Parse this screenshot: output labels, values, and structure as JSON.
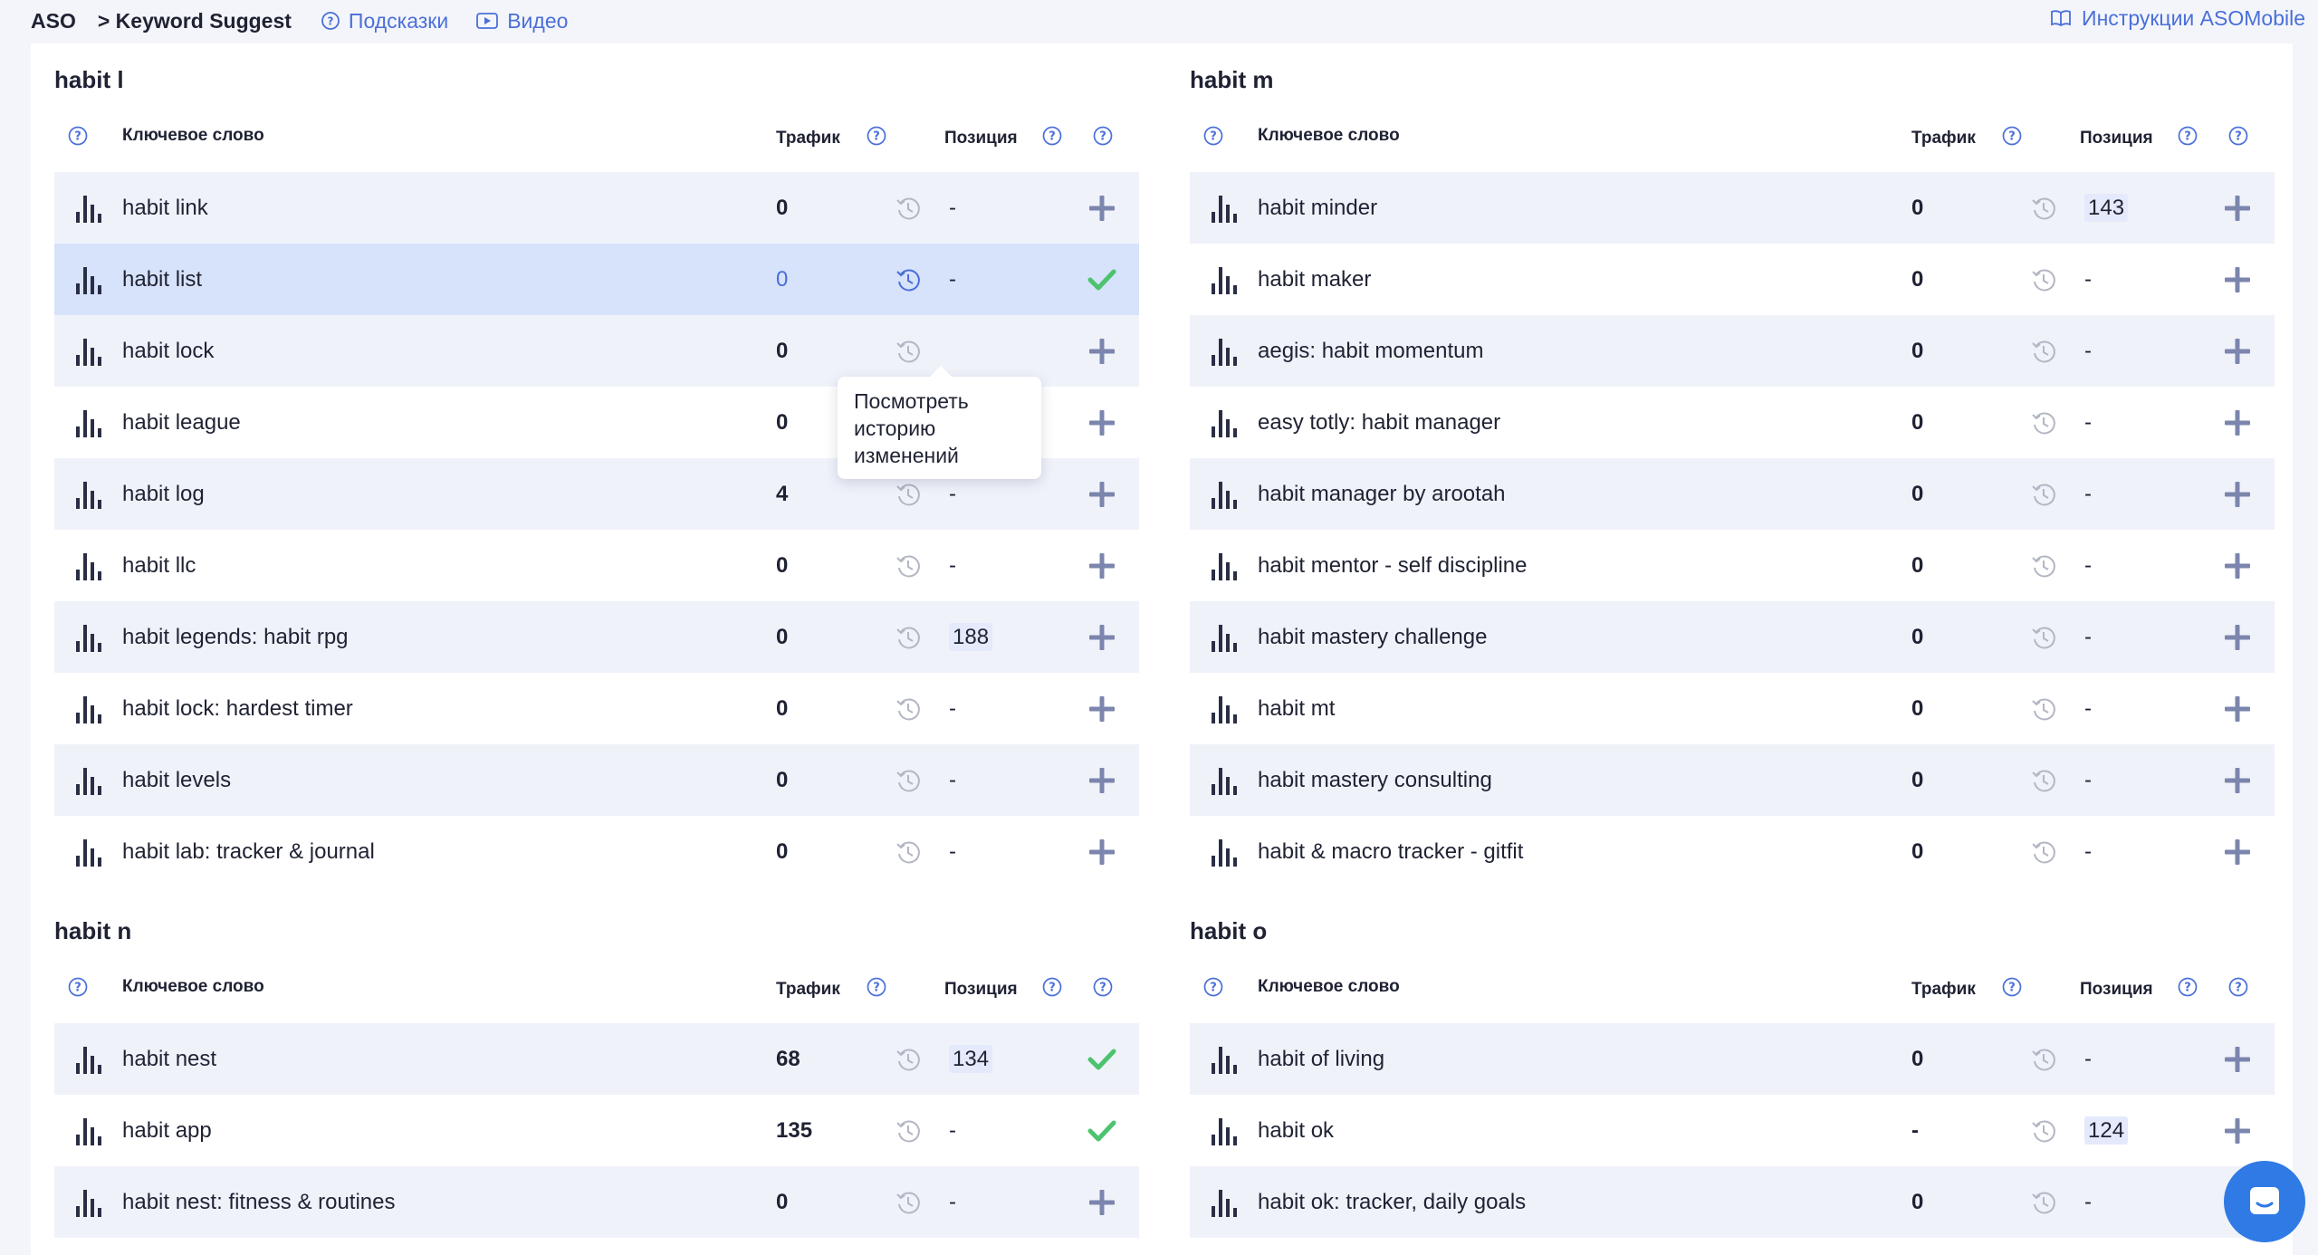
{
  "breadcrumb": {
    "root": "ASO",
    "current": "> Keyword Suggest"
  },
  "top_links": {
    "hints": "Подсказки",
    "video": "Видео",
    "instructions": "Инструкции ASOMobile"
  },
  "colors": {
    "accent": "#4a6fd9",
    "check": "#4cc36f",
    "plus": "#7b85ad",
    "row_alt": "#f0f2fa",
    "row_selected": "#d7e2fb"
  },
  "tooltip": "Посмотреть историю изменений",
  "panels": [
    {
      "title": "habit l",
      "headers": {
        "keyword": "Ключевое слово",
        "traffic": "Трафик",
        "position": "Позиция"
      },
      "rows": [
        {
          "keyword": "habit link",
          "traffic": "0",
          "position": "-",
          "action": "plus"
        },
        {
          "keyword": "habit list",
          "traffic": "0",
          "position": "-",
          "action": "check"
        },
        {
          "keyword": "habit lock",
          "traffic": "0",
          "position": "",
          "action": "plus"
        },
        {
          "keyword": "habit league",
          "traffic": "0",
          "position": "",
          "action": "plus"
        },
        {
          "keyword": "habit log",
          "traffic": "4",
          "position": "-",
          "action": "plus"
        },
        {
          "keyword": "habit llc",
          "traffic": "0",
          "position": "-",
          "action": "plus"
        },
        {
          "keyword": "habit legends: habit rpg",
          "traffic": "0",
          "position": "188",
          "action": "plus"
        },
        {
          "keyword": "habit lock: hardest timer",
          "traffic": "0",
          "position": "-",
          "action": "plus"
        },
        {
          "keyword": "habit levels",
          "traffic": "0",
          "position": "-",
          "action": "plus"
        },
        {
          "keyword": "habit lab: tracker & journal",
          "traffic": "0",
          "position": "-",
          "action": "plus"
        }
      ]
    },
    {
      "title": "habit m",
      "headers": {
        "keyword": "Ключевое слово",
        "traffic": "Трафик",
        "position": "Позиция"
      },
      "rows": [
        {
          "keyword": "habit minder",
          "traffic": "0",
          "position": "143",
          "action": "plus"
        },
        {
          "keyword": "habit maker",
          "traffic": "0",
          "position": "-",
          "action": "plus"
        },
        {
          "keyword": "aegis: habit momentum",
          "traffic": "0",
          "position": "-",
          "action": "plus"
        },
        {
          "keyword": "easy totly: habit manager",
          "traffic": "0",
          "position": "-",
          "action": "plus"
        },
        {
          "keyword": "habit manager by arootah",
          "traffic": "0",
          "position": "-",
          "action": "plus"
        },
        {
          "keyword": "habit mentor - self discipline",
          "traffic": "0",
          "position": "-",
          "action": "plus"
        },
        {
          "keyword": "habit mastery challenge",
          "traffic": "0",
          "position": "-",
          "action": "plus"
        },
        {
          "keyword": "habit mt",
          "traffic": "0",
          "position": "-",
          "action": "plus"
        },
        {
          "keyword": "habit mastery consulting",
          "traffic": "0",
          "position": "-",
          "action": "plus"
        },
        {
          "keyword": "habit & macro tracker - gitfit",
          "traffic": "0",
          "position": "-",
          "action": "plus"
        }
      ]
    },
    {
      "title": "habit n",
      "headers": {
        "keyword": "Ключевое слово",
        "traffic": "Трафик",
        "position": "Позиция"
      },
      "rows": [
        {
          "keyword": "habit nest",
          "traffic": "68",
          "position": "134",
          "action": "check"
        },
        {
          "keyword": "habit app",
          "traffic": "135",
          "position": "-",
          "action": "check"
        },
        {
          "keyword": "habit nest: fitness & routines",
          "traffic": "0",
          "position": "-",
          "action": "plus"
        }
      ]
    },
    {
      "title": "habit o",
      "headers": {
        "keyword": "Ключевое слово",
        "traffic": "Трафик",
        "position": "Позиция"
      },
      "rows": [
        {
          "keyword": "habit of living",
          "traffic": "0",
          "position": "-",
          "action": "plus"
        },
        {
          "keyword": "habit ok",
          "traffic": "-",
          "position": "124",
          "action": "plus"
        },
        {
          "keyword": "habit ok: tracker, daily goals",
          "traffic": "0",
          "position": "-",
          "action": "plus"
        }
      ]
    }
  ]
}
